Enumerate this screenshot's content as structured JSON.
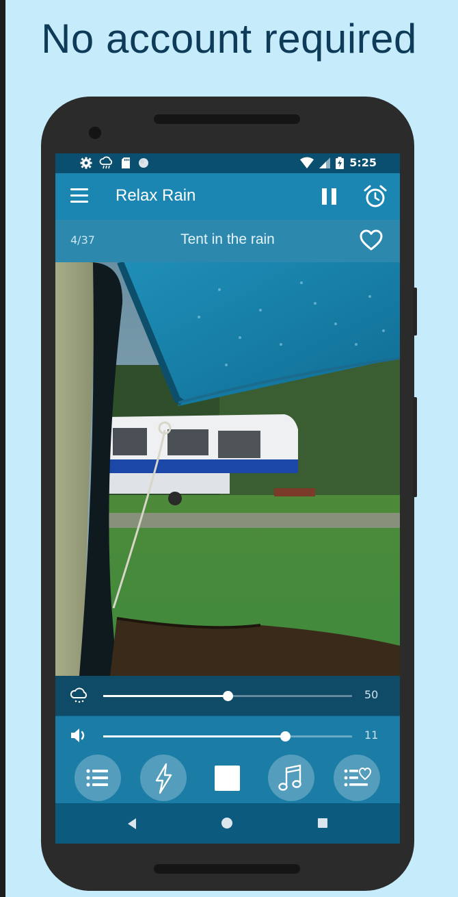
{
  "promo": {
    "headline": "No account required"
  },
  "status_bar": {
    "time": "5:25"
  },
  "app_bar": {
    "title": "Relax Rain"
  },
  "track": {
    "counter": "4/37",
    "name": "Tent in the rain"
  },
  "sliders": {
    "rain": {
      "value": "50",
      "level": 0.5,
      "icon": "rain-cloud-icon"
    },
    "volume": {
      "value": "11",
      "level": 0.73,
      "icon": "speaker-icon"
    }
  },
  "controls": [
    "list-icon",
    "lightning-icon",
    "stop-icon",
    "music-note-icon",
    "favorites-list-icon"
  ],
  "colors": {
    "background": "#c6ecfc",
    "headline": "#0d3b58",
    "app_bar": "#1a86b1",
    "status_bar": "#0a4e70",
    "control_panel": "#1b7ca6"
  }
}
